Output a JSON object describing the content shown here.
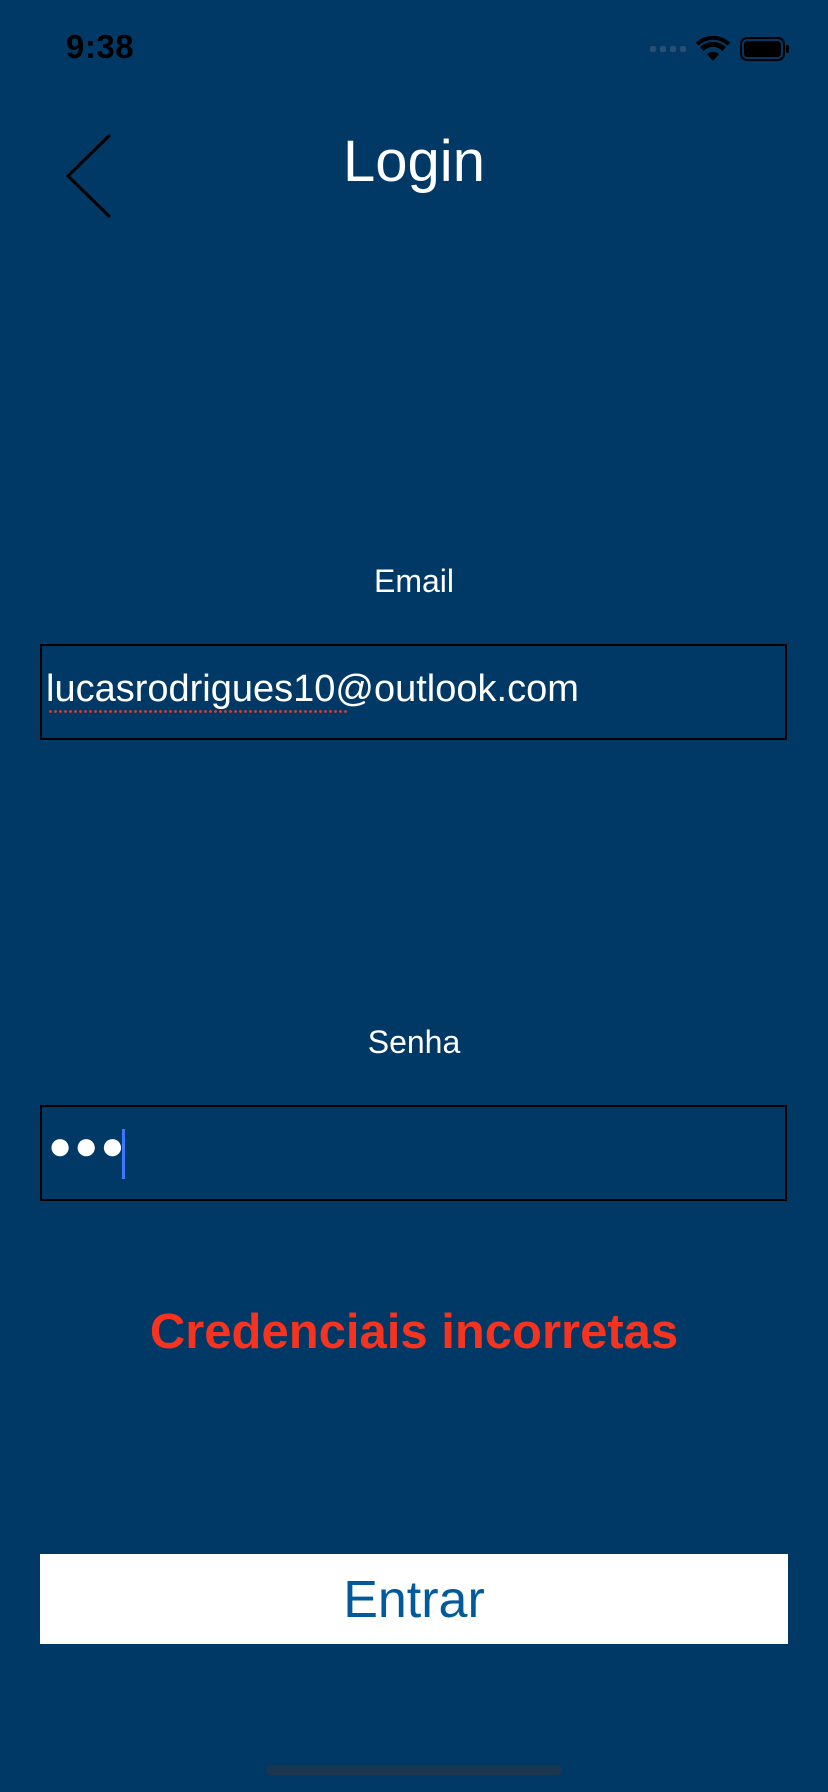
{
  "status_bar": {
    "time": "9:38",
    "icons": [
      "cellular-signal-icon",
      "wifi-icon",
      "battery-icon"
    ]
  },
  "nav": {
    "title": "Login",
    "back_icon": "chevron-left-icon"
  },
  "form": {
    "email_label": "Email",
    "email_value": "lucasrodrigues10@outlook.com",
    "password_label": "Senha",
    "password_value": "●●●"
  },
  "error": {
    "message": "Credenciais incorretas",
    "color": "#f5331f"
  },
  "submit": {
    "label": "Entrar"
  },
  "colors": {
    "background": "#003966",
    "button_background": "#ffffff",
    "button_text": "#005a9c",
    "cursor": "#3a78ff"
  }
}
